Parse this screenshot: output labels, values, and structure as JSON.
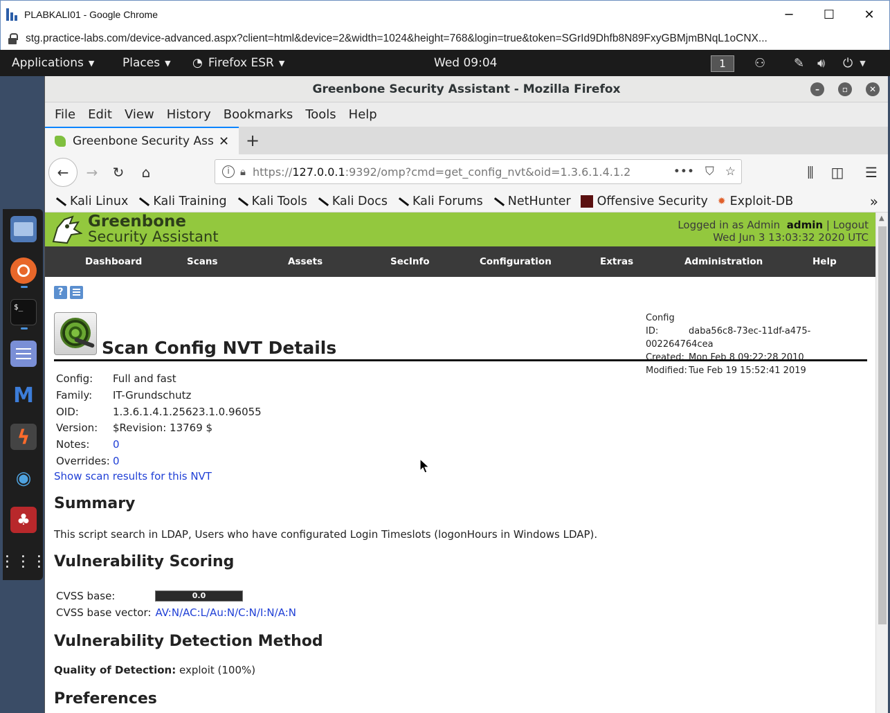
{
  "chrome": {
    "title": "PLABKALI01 - Google Chrome",
    "url": "stg.practice-labs.com/device-advanced.aspx?client=html&device=2&width=1024&height=768&login=true&token=SGrId9Dhfb8N89FxyGBMjmBNqL1oCNX...",
    "minimize": "─",
    "maximize": "☐",
    "close": "✕"
  },
  "kali_panel": {
    "applications": "Applications",
    "places": "Places",
    "firefox": "Firefox ESR",
    "clock": "Wed 09:04",
    "workspace": "1"
  },
  "firefox": {
    "window_title": "Greenbone Security Assistant - Mozilla Firefox",
    "menu": [
      "File",
      "Edit",
      "View",
      "History",
      "Bookmarks",
      "Tools",
      "Help"
    ],
    "tab_label": "Greenbone Security Assistant",
    "url_prefix": "https://",
    "url_host": "127.0.0.1",
    "url_rest": ":9392/omp?cmd=get_config_nvt&oid=1.3.6.1.4.1.2",
    "bookmarks": [
      "Kali Linux",
      "Kali Training",
      "Kali Tools",
      "Kali Docs",
      "Kali Forums",
      "NetHunter",
      "Offensive Security",
      "Exploit-DB"
    ]
  },
  "gsa": {
    "logo_line1": "Greenbone",
    "logo_line2": "Security Assistant",
    "logged_in_prefix": "Logged in as  Admin",
    "user": "admin",
    "logout": "Logout",
    "datetime": "Wed Jun 3 13:03:32 2020 UTC",
    "nav": [
      "Dashboard",
      "Scans",
      "Assets",
      "SecInfo",
      "Configuration",
      "Extras",
      "Administration",
      "Help"
    ],
    "page_title": "Scan Config NVT Details",
    "meta": {
      "config_id_label": "Config ID:",
      "config_id": "daba56c8-73ec-11df-a475-002264764cea",
      "created_label": "Created:",
      "created": "Mon Feb 8 09:22:28 2010",
      "modified_label": "Modified:",
      "modified": "Tue Feb 19 15:52:41 2019"
    },
    "details": {
      "config_label": "Config:",
      "config": "Full and fast",
      "family_label": "Family:",
      "family": "IT-Grundschutz",
      "oid_label": "OID:",
      "oid": "1.3.6.1.4.1.25623.1.0.96055",
      "version_label": "Version:",
      "version": "$Revision: 13769 $",
      "notes_label": "Notes:",
      "notes": "0",
      "overrides_label": "Overrides:",
      "overrides": "0"
    },
    "show_results_link": "Show scan results for this NVT",
    "summary_heading": "Summary",
    "summary_text": "This script search in LDAP, Users who have configurated Login Timeslots (logonHours in Windows LDAP).",
    "scoring_heading": "Vulnerability Scoring",
    "cvss_base_label": "CVSS base:",
    "cvss_base": "0.0",
    "cvss_vector_label": "CVSS base vector:",
    "cvss_vector": "AV:N/AC:L/Au:N/C:N/I:N/A:N",
    "detection_heading": "Vulnerability Detection Method",
    "qod_label": "Quality of Detection:",
    "qod_value": "exploit (100%)",
    "preferences_heading": "Preferences"
  }
}
